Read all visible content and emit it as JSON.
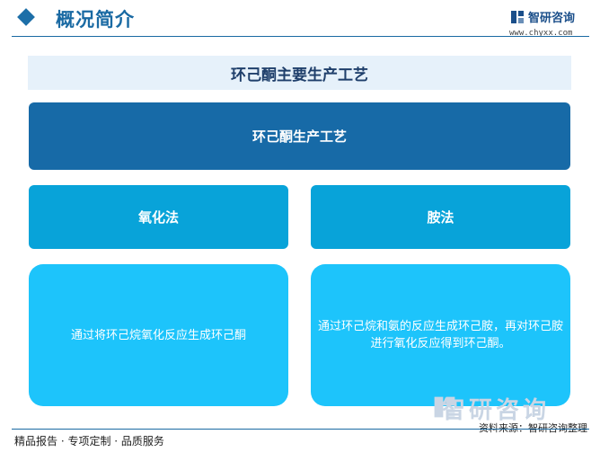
{
  "header": {
    "section_title": "概况简介",
    "logo_name": "智研咨询",
    "logo_url": "www.chyxx.com"
  },
  "diagram": {
    "title": "环己酮主要生产工艺",
    "root": "环己酮生产工艺",
    "branches": [
      {
        "label": "氧化法",
        "description": "通过将环己烷氧化反应生成环己酮"
      },
      {
        "label": "胺法",
        "description": "通过环己烷和氨的反应生成环己胺，再对环己胺进行氧化反应得到环己酮。"
      }
    ]
  },
  "footer": {
    "left": "精品报告 · 专项定制 · 品质服务",
    "source": "资料来源：智研咨询整理",
    "watermark": "智研咨询"
  },
  "colors": {
    "primary": "#176aa7",
    "secondary": "#08a3d9",
    "light": "#1dc4fb",
    "band": "#e6f1fa"
  }
}
